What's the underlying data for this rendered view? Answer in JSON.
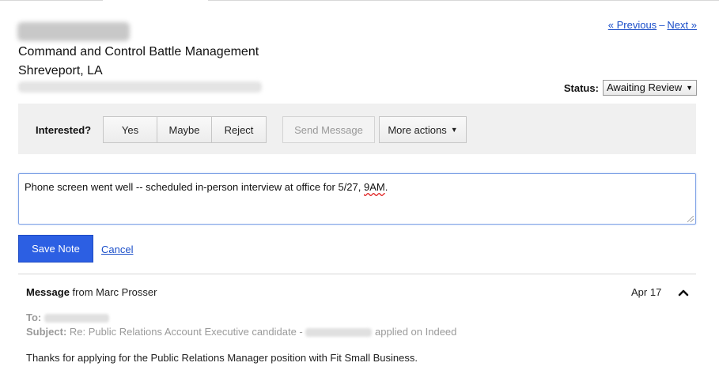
{
  "candidate": {
    "job_title": "Command and Control Battle Management",
    "location": "Shreveport, LA"
  },
  "pager": {
    "previous": "« Previous",
    "separator": "–",
    "next": "Next »"
  },
  "status": {
    "label": "Status:",
    "value": "Awaiting Review"
  },
  "actions": {
    "interested_label": "Interested?",
    "yes": "Yes",
    "maybe": "Maybe",
    "reject": "Reject",
    "send_message": "Send Message",
    "more_actions": "More actions"
  },
  "note": {
    "text_main": "Phone screen went well -- scheduled in-person interview at office for 5/27, ",
    "text_flagged": "9AM",
    "text_end": ".",
    "save_label": "Save Note",
    "cancel_label": "Cancel"
  },
  "message": {
    "title_bold": "Message",
    "from": "from Marc Prosser",
    "date": "Apr 17",
    "to_label": "To:",
    "subject_label": "Subject:",
    "subject_start": "Re: Public Relations Account Executive candidate -",
    "subject_end": "applied on Indeed",
    "body": "Thanks for applying for the Public Relations Manager position with Fit Small Business."
  },
  "colors": {
    "link": "#1a4ec9",
    "primary_button": "#2c5fe3",
    "action_bar_bg": "#f0f0f0"
  },
  "icons": {
    "collapse": "chevron-up-icon",
    "dropdown": "caret-down-icon"
  }
}
